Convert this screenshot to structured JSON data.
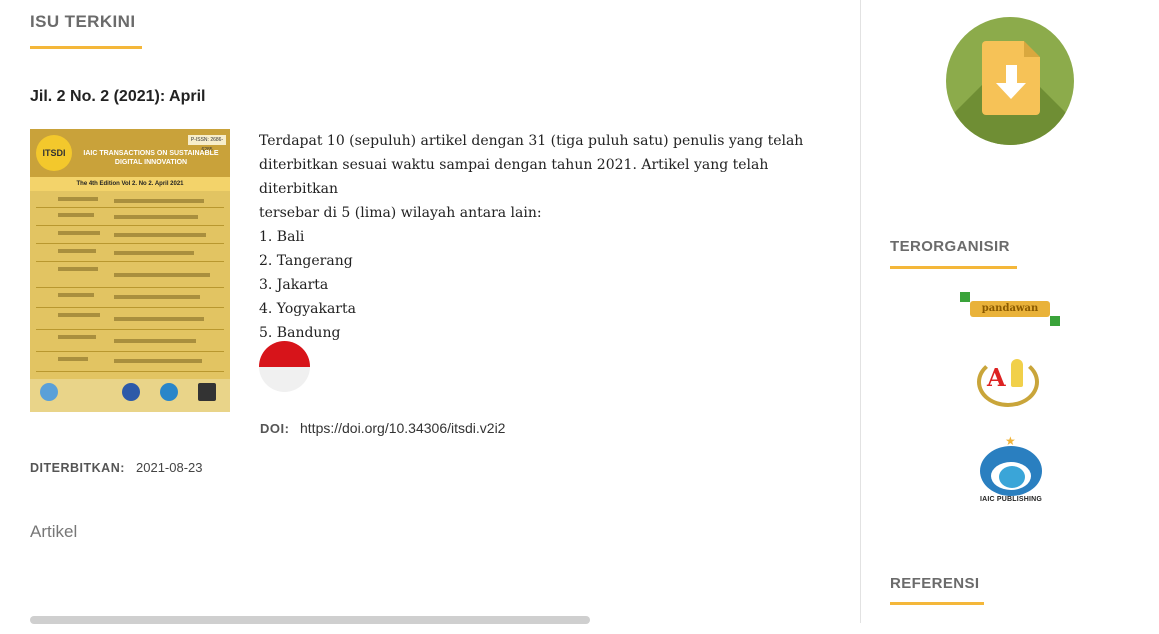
{
  "main": {
    "section_title": "ISU TERKINI",
    "issue_title": "Jil. 2 No. 2 (2021): April",
    "cover": {
      "logo_text": "ITSDI",
      "issn_text": "P-ISSN: 2686-6285",
      "title": "IAIC TRANSACTIONS ON SUSTAINABLE DIGITAL INNOVATION",
      "edition": "The 4th Edition Vol 2. No 2. April 2021"
    },
    "abstract_lines": [
      "Terdapat 10 (sepuluh) artikel dengan 31 (tiga puluh satu) penulis yang telah",
      "diterbitkan sesuai waktu sampai dengan tahun 2021. Artikel yang telah diterbitkan",
      "tersebar di 5 (lima) wilayah antara lain:",
      "1. Bali",
      "2. Tangerang",
      "3. Jakarta",
      "4. Yogyakarta",
      "5. Bandung"
    ],
    "doi_label": "DOI:",
    "doi_value": "https://doi.org/10.34306/itsdi.v2i2",
    "published_label": "DITERBITKAN:",
    "published_date": "2021-08-23",
    "category": "Artikel"
  },
  "sidebar": {
    "download_icon": "download-file-icon",
    "organizer_title": "TERORGANISIR",
    "organizers": [
      {
        "name": "pandawan"
      },
      {
        "name": "aa-logo"
      },
      {
        "name": "IAIC PUBLISHING"
      }
    ],
    "reference_title": "REFERENSI"
  },
  "colors": {
    "accent_underline": "#f4b73a",
    "download_circle": "#8cab4b",
    "flag_red": "#d7141a"
  }
}
